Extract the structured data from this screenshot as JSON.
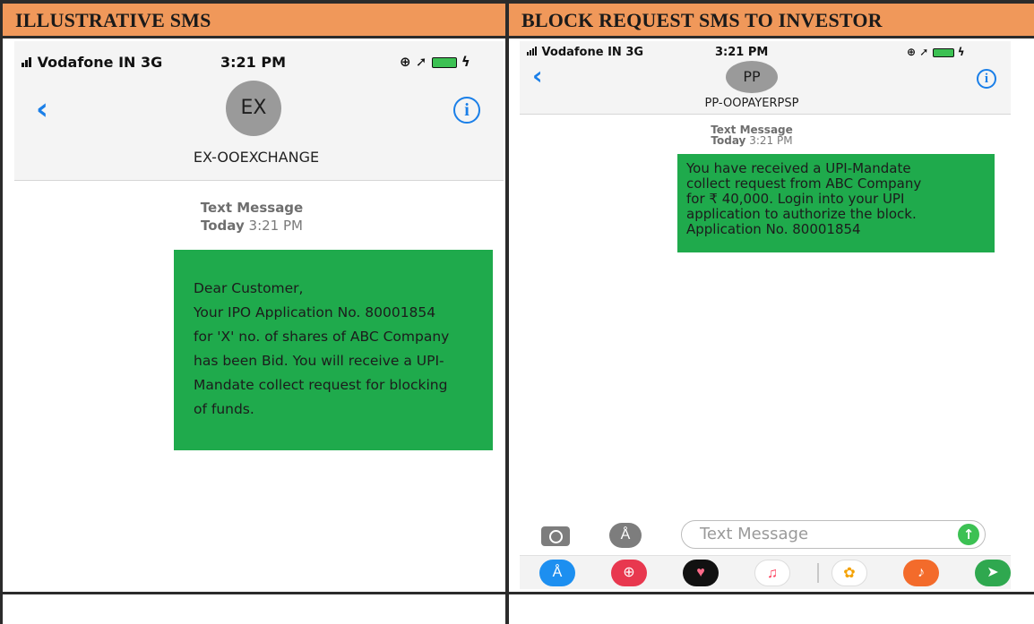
{
  "panels": [
    {
      "header": "ILLUSTRATIVE SMS",
      "status": {
        "carrier": "Vodafone IN  3G",
        "time": "3:21 PM"
      },
      "avatar": "EX",
      "contact": "EX-OOEXCHANGE",
      "meta": {
        "line1": "Text Message",
        "line2_day": "Today",
        "line2_time": "3:21 PM"
      },
      "message_lines": [
        "Dear Customer,",
        "Your IPO Application No. 80001854",
        "for 'X' no. of shares of ABC Company",
        "has been Bid. You will receive a UPI-",
        "Mandate collect request for blocking",
        "of funds."
      ]
    },
    {
      "header": "BLOCK REQUEST SMS TO INVESTOR",
      "status": {
        "carrier": "Vodafone IN  3G",
        "time": "3:21 PM"
      },
      "avatar": "PP",
      "contact": "PP-OOPAYERPSP",
      "meta": {
        "line1": "Text Message",
        "line2_day": "Today",
        "line2_time": "3:21 PM"
      },
      "message_lines": [
        "You have received a UPI-Mandate",
        "collect request from ABC Company",
        "for ₹ 40,000. Login into your UPI",
        "application to authorize the block.",
        "Application No. 80001854"
      ],
      "compose_placeholder": "Text Message",
      "tray_apps": [
        "app-store-icon",
        "search-globe-icon",
        "heart-icon",
        "music-icon",
        "photos-icon",
        "guitar-icon",
        "maps-icon"
      ]
    }
  ],
  "colors": {
    "header_bg": "#f0985a",
    "bubble": "#1faa4c",
    "ios_blue": "#1a7fe8"
  }
}
